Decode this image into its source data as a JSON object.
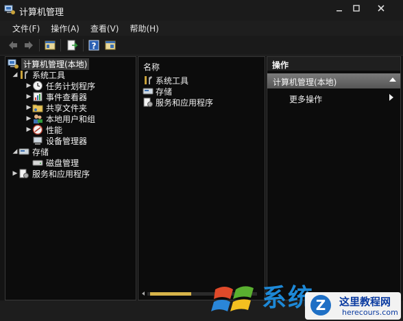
{
  "window": {
    "title": "计算机管理"
  },
  "menubar": {
    "items": [
      "文件(F)",
      "操作(A)",
      "查看(V)",
      "帮助(H)"
    ]
  },
  "toolbar": {
    "buttons": [
      {
        "icon": "back-arrow-icon"
      },
      {
        "icon": "forward-arrow-icon"
      },
      {
        "icon": "console-tree-icon"
      },
      {
        "icon": "export-list-icon"
      },
      {
        "icon": "help-icon"
      },
      {
        "icon": "properties-icon"
      }
    ]
  },
  "tree": {
    "root": "计算机管理(本地)",
    "system_tools": {
      "label": "系统工具",
      "children": [
        "任务计划程序",
        "事件查看器",
        "共享文件夹",
        "本地用户和组",
        "性能",
        "设备管理器"
      ]
    },
    "storage": {
      "label": "存储",
      "children": [
        "磁盘管理"
      ]
    },
    "services": {
      "label": "服务和应用程序"
    }
  },
  "list": {
    "header": "名称",
    "rows": [
      "系统工具",
      "存储",
      "服务和应用程序"
    ]
  },
  "actions": {
    "header": "操作",
    "subheader": "计算机管理(本地)",
    "more": "更多操作"
  },
  "watermark": {
    "text1": "系统",
    "badge_line1": "这里教程网",
    "badge_line2": "herecours.com",
    "badge_logo": "Z"
  }
}
